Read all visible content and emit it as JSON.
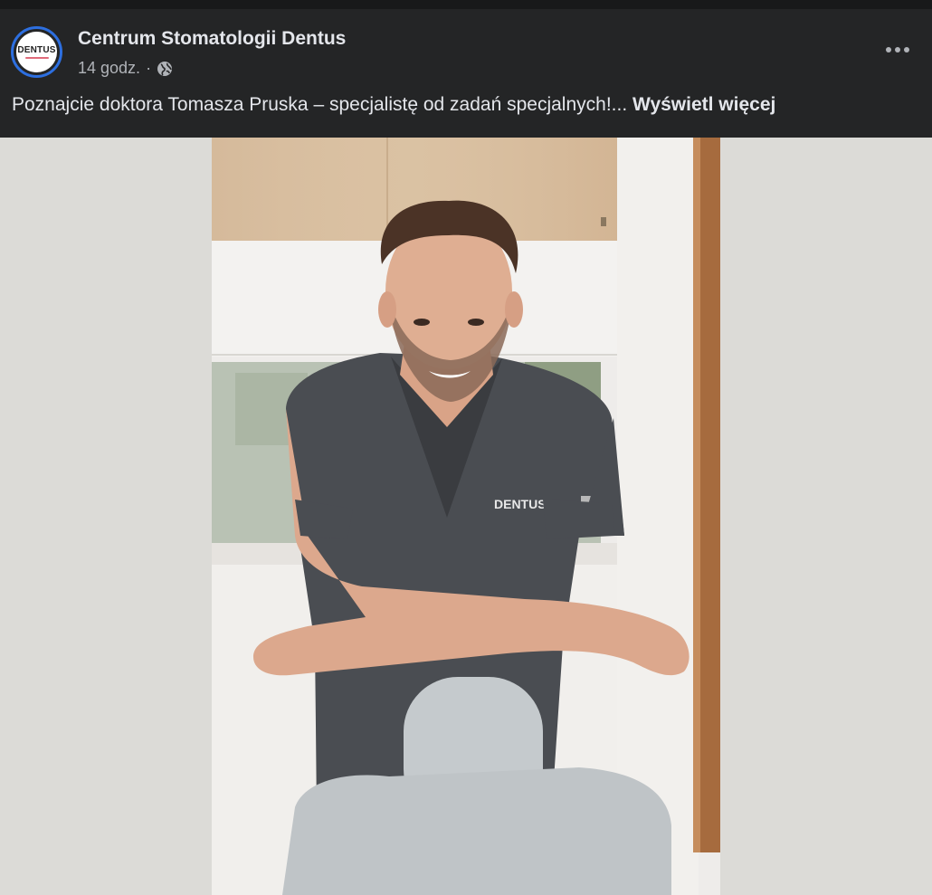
{
  "post": {
    "page_name": "Centrum Stomatologii Dentus",
    "timestamp": "14 godz.",
    "separator": "·",
    "audience_icon": "globe-icon",
    "avatar_logo_text": "DENTUS",
    "more_icon": "more-options-icon",
    "caption_text": "Poznajcie doktora Tomasza Pruska – specjalistę od zadań specjalnych!...",
    "see_more_label": "Wyświetl więcej",
    "photo": {
      "description_icon": "post-photo",
      "scrub_logo_text": "DENTUS"
    }
  },
  "colors": {
    "background": "#242526",
    "text_primary": "#e4e6eb",
    "text_secondary": "#b0b3b8",
    "avatar_ring": "#2d6fe0"
  }
}
